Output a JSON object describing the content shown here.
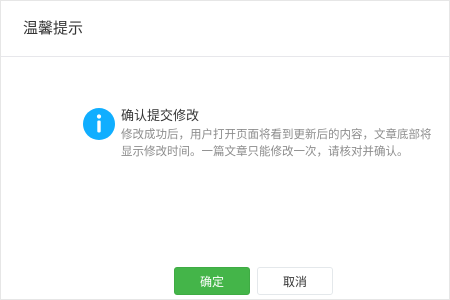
{
  "dialog": {
    "title": "温馨提示",
    "icon": "info-icon",
    "accent_color": "#10aeff",
    "message_title": "确认提交修改",
    "message_body": "修改成功后，用户打开页面将看到更新后的内容，文章底部将显示修改时间。一篇文章只能修改一次，请核对并确认。",
    "confirm_label": "确定",
    "cancel_label": "取消",
    "confirm_color": "#44b549"
  }
}
